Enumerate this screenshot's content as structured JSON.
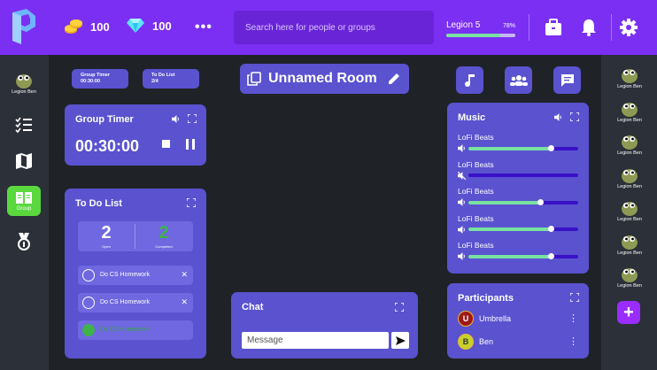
{
  "colors": {
    "topbar": "#7b2ff2",
    "card": "#5a52cf",
    "accent_green": "#5ad83e",
    "progress_green": "#78e2a0",
    "background": "#1f2328"
  },
  "header": {
    "coins": "100",
    "gems": "100",
    "more": "•••",
    "search_placeholder": "Search here for people or groups",
    "level_name": "Legion 5",
    "level_pct_label": "78%",
    "level_progress": 0.78
  },
  "leftnav": {
    "profile_name": "Legion Ben",
    "group_label": "Group"
  },
  "pills": {
    "timer_title": "Group Timer",
    "timer_value": "00:30:00",
    "todo_title": "To Do List",
    "todo_value": "2/4"
  },
  "room": {
    "title": "Unnamed Room"
  },
  "timer": {
    "title": "Group Timer",
    "value": "00:30:00"
  },
  "todo": {
    "title": "To Do List",
    "open_count": "2",
    "open_label": "Open",
    "completed_count": "2",
    "completed_label": "Completed",
    "items": [
      {
        "text": "Do CS Homework",
        "done": false
      },
      {
        "text": "Do CS Homework",
        "done": false
      },
      {
        "text": "Do CS Homework",
        "done": true
      }
    ]
  },
  "chat": {
    "title": "Chat",
    "placeholder": "Message"
  },
  "music": {
    "title": "Music",
    "tracks": [
      {
        "name": "LoFi Beats",
        "volume": 0.75,
        "muted": false
      },
      {
        "name": "LoFi Beats",
        "volume": 0.0,
        "muted": true
      },
      {
        "name": "LoFi Beats",
        "volume": 0.65,
        "muted": false
      },
      {
        "name": "LoFi Beats",
        "volume": 0.75,
        "muted": false
      },
      {
        "name": "LoFi Beats",
        "volume": 0.75,
        "muted": false
      }
    ]
  },
  "participants": {
    "title": "Participants",
    "list": [
      {
        "initial": "U",
        "name": "Umbrella",
        "color": "#a01818"
      },
      {
        "initial": "B",
        "name": "Ben",
        "color": "#c8d12a"
      }
    ]
  },
  "rail": {
    "users": [
      "Legion Ben",
      "Legion Ben",
      "Legion Ben",
      "Legion Ben",
      "Legion Ben",
      "Legion Ben",
      "Legion Ben"
    ],
    "add": "+"
  }
}
